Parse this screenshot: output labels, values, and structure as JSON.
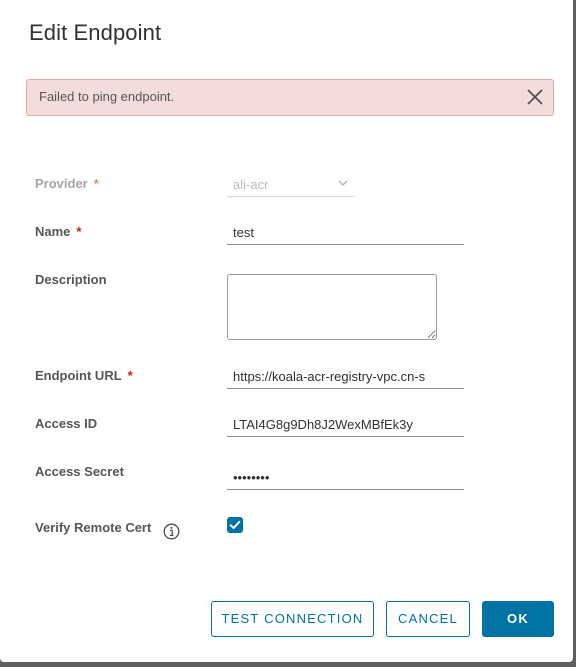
{
  "dialog": {
    "title": "Edit Endpoint"
  },
  "alert": {
    "message": "Failed to ping endpoint."
  },
  "form": {
    "provider": {
      "label": "Provider",
      "required_mark": "*",
      "value": "ali-acr"
    },
    "name": {
      "label": "Name",
      "required_mark": "*",
      "value": "test"
    },
    "description": {
      "label": "Description",
      "value": ""
    },
    "endpoint_url": {
      "label": "Endpoint URL",
      "required_mark": "*",
      "value": "https://koala-acr-registry-vpc.cn-s"
    },
    "access_id": {
      "label": "Access ID",
      "value": "LTAI4G8g9Dh8J2WexMBfEk3y"
    },
    "access_secret": {
      "label": "Access Secret",
      "value": "abcdefgh"
    },
    "verify_remote_cert": {
      "label": "Verify Remote Cert",
      "checked": true
    }
  },
  "buttons": {
    "test_connection": "TEST CONNECTION",
    "cancel": "CANCEL",
    "ok": "OK"
  },
  "colors": {
    "accent": "#0072a3",
    "alert_bg": "#f4dcdc",
    "alert_border": "#e8a6a6",
    "required": "#c92100"
  },
  "icons": {
    "alert_close": "close-icon",
    "provider_select": "chevron-down-icon",
    "verify_info": "info-icon",
    "checkbox": "checkmark-icon"
  }
}
